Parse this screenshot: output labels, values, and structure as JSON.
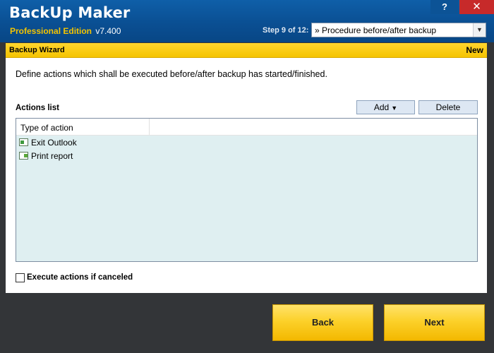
{
  "app": {
    "title": "BackUp Maker",
    "edition": "Professional Edition",
    "version": "v7.400"
  },
  "window_controls": {
    "help_label": "?",
    "close_label": "✕"
  },
  "step": {
    "label": "Step 9 of 12:",
    "selected": "» Procedure before/after backup"
  },
  "wizard": {
    "title": "Backup Wizard",
    "badge": "New",
    "description": "Define actions which shall be executed before/after backup has started/finished."
  },
  "actions": {
    "label": "Actions list",
    "add_label": "Add",
    "delete_label": "Delete",
    "column_header": "Type of action",
    "items": [
      {
        "label": "Exit Outlook",
        "icon": "exit-program-icon"
      },
      {
        "label": "Print report",
        "icon": "print-report-icon"
      }
    ]
  },
  "options": {
    "execute_if_canceled_label": "Execute actions if canceled",
    "execute_if_canceled_checked": false
  },
  "footer": {
    "back_label": "Back",
    "next_label": "Next"
  },
  "colors": {
    "header_blue": "#0a4f93",
    "edition_yellow": "#f4c400",
    "wizard_bar_yellow": "#f5c400",
    "list_background": "#dfeff1",
    "close_red": "#c72a2a"
  }
}
